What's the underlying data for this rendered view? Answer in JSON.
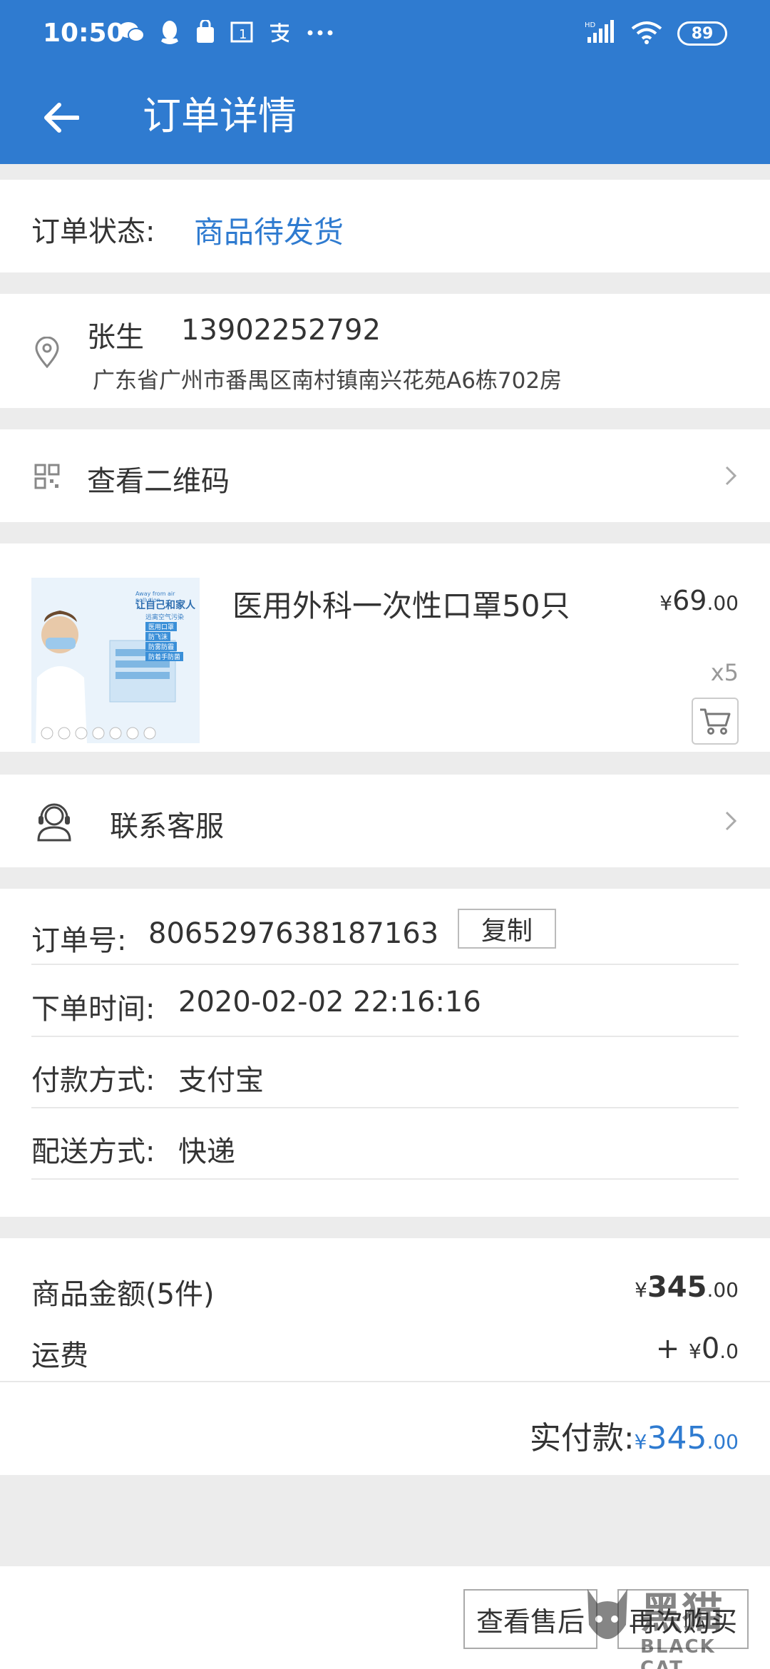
{
  "status_bar": {
    "time": "10:50",
    "notif_icons": [
      "wechat-icon",
      "qq-icon",
      "bag-icon",
      "calendar-icon",
      "alipay-icon",
      "more-icon"
    ],
    "battery": "89"
  },
  "appbar": {
    "title": "订单详情"
  },
  "order_status": {
    "label": "订单状态:",
    "value": "商品待发货"
  },
  "address": {
    "name": "张生",
    "phone": "13902252792",
    "line": "广东省广州市番禺区南村镇南兴花苑A6栋702房"
  },
  "qrcode": {
    "label": "查看二维码"
  },
  "product": {
    "name": "医用外科一次性口罩50只",
    "price_symbol": "¥",
    "price_int": "69",
    "price_dec": ".00",
    "quantity": "x5",
    "thumb_text_1": "让自己和家人",
    "thumb_text_2": "远离空气污染",
    "thumb_tags": [
      "医用口罩",
      "防飞沫",
      "防雾防霾",
      "防着手防菌"
    ],
    "thumb_small_en": "Away from air pollution"
  },
  "service": {
    "label": "联系客服"
  },
  "order_info": {
    "order_no_label": "订单号:",
    "order_no": "8065297638187163",
    "copy_label": "复制",
    "time_label": "下单时间:",
    "time_value": "2020-02-02 22:16:16",
    "pay_label": "付款方式:",
    "pay_value": "支付宝",
    "ship_label": "配送方式:",
    "ship_value": "快递"
  },
  "amounts": {
    "goods_label": "商品金额(5件)",
    "goods_symbol": "¥",
    "goods_int": "345",
    "goods_dec": ".00",
    "freight_label": "运费",
    "freight_prefix": "+ ",
    "freight_symbol": "¥",
    "freight_int": "0",
    "freight_dec": ".0",
    "paid_label": "实付款:",
    "paid_symbol": "¥",
    "paid_int": "345",
    "paid_dec": ".00"
  },
  "bottom": {
    "after_sale_label": "查看售后",
    "rebuy_label": "再次购买"
  },
  "watermark": {
    "cn": "黑猫",
    "en": "BLACK CAT"
  },
  "colors": {
    "primary": "#2f7bd0",
    "background": "#ececec"
  }
}
